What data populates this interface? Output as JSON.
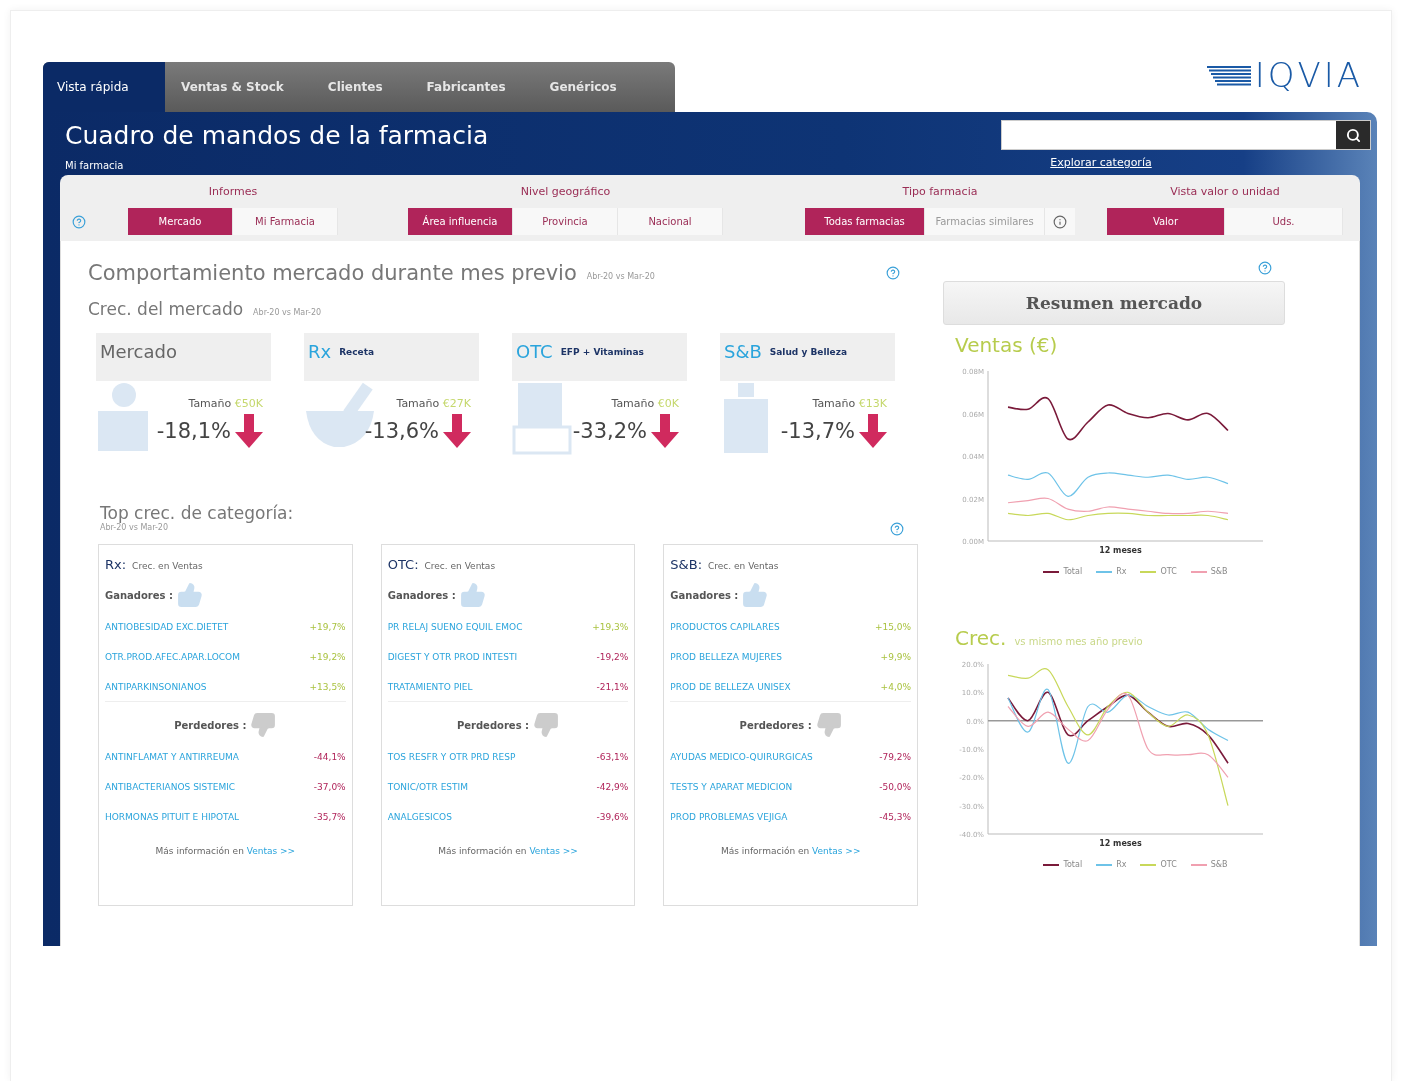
{
  "tabs": [
    {
      "label": "Vista rápida",
      "selected": true
    },
    {
      "label": "Ventas & Stock",
      "selected": false
    },
    {
      "label": "Clientes",
      "selected": false
    },
    {
      "label": "Fabricantes",
      "selected": false
    },
    {
      "label": "Genéricos",
      "selected": false
    }
  ],
  "logo": "IQVIA",
  "header": {
    "title": "Cuadro de mandos de la farmacia",
    "subtitle": "Mi farmacia",
    "explore_link": "Explorar categoría"
  },
  "filters": [
    {
      "label": "Informes",
      "help_icon": true,
      "info_icon": false,
      "options": [
        {
          "label": "Mercado",
          "selected": true
        },
        {
          "label": "Mi Farmacia",
          "selected": false
        }
      ]
    },
    {
      "label": "Nivel geográfico",
      "help_icon": false,
      "info_icon": false,
      "options": [
        {
          "label": "Área influencia",
          "selected": true
        },
        {
          "label": "Provincia",
          "selected": false
        },
        {
          "label": "Nacional",
          "selected": false
        }
      ]
    },
    {
      "label": "Tipo farmacia",
      "help_icon": false,
      "info_icon": true,
      "options": [
        {
          "label": "Todas farmacias",
          "selected": true
        },
        {
          "label": "Farmacias similares",
          "selected": false
        }
      ]
    },
    {
      "label": "Vista valor o unidad",
      "help_icon": false,
      "info_icon": false,
      "options": [
        {
          "label": "Valor",
          "selected": true
        },
        {
          "label": "Uds.",
          "selected": false
        }
      ]
    }
  ],
  "market": {
    "title": "Comportamiento mercado durante mes previo",
    "period": "Abr-20 vs Mar-20",
    "growth_title": "Crec. del mercado",
    "growth_period": "Abr-20 vs Mar-20",
    "cards": [
      {
        "kind": "mercado",
        "code": "Mercado",
        "size_label": "Tamaño",
        "size_value": "€50K",
        "change": "-18,1%",
        "declining": true
      },
      {
        "kind": "rx",
        "code": "Rx",
        "name": "Receta",
        "size_label": "Tamaño",
        "size_value": "€27K",
        "change": "-13,6%",
        "declining": true
      },
      {
        "kind": "otc",
        "code": "OTC",
        "name": "EFP + Vitaminas",
        "size_label": "Tamaño",
        "size_value": "€0K",
        "change": "-33,2%",
        "declining": true
      },
      {
        "kind": "sb",
        "code": "S&B",
        "name": "Salud y Belleza",
        "size_label": "Tamaño",
        "size_value": "€13K",
        "change": "-13,7%",
        "declining": true
      }
    ]
  },
  "top": {
    "title": "Top crec. de categoría:",
    "period": "Abr-20 vs Mar-20",
    "panels": [
      {
        "code": "Rx:",
        "label": "Crec. en Ventas",
        "winners_label": "Ganadores :",
        "losers_label": "Perdedores :",
        "more_text": "Más información en",
        "more_link": "Ventas >>",
        "winners": [
          {
            "name": "ANTIOBESIDAD EXC.DIETET",
            "value": "+19,7%",
            "positive": true
          },
          {
            "name": "OTR.PROD.AFEC.APAR.LOCOM",
            "value": "+19,2%",
            "positive": true
          },
          {
            "name": "ANTIPARKINSONIANOS",
            "value": "+13,5%",
            "positive": true
          }
        ],
        "losers": [
          {
            "name": "ANTINFLAMAT Y ANTIRREUMA",
            "value": "-44,1%",
            "positive": false
          },
          {
            "name": "ANTIBACTERIANOS SISTEMIC",
            "value": "-37,0%",
            "positive": false
          },
          {
            "name": "HORMONAS PITUIT E HIPOTAL",
            "value": "-35,7%",
            "positive": false
          }
        ]
      },
      {
        "code": "OTC:",
        "label": "Crec. en Ventas",
        "winners_label": "Ganadores :",
        "losers_label": "Perdedores :",
        "more_text": "Más información en",
        "more_link": "Ventas >>",
        "winners": [
          {
            "name": "PR RELAJ SUENO EQUIL EMOC",
            "value": "+19,3%",
            "positive": true
          },
          {
            "name": "DIGEST Y OTR PROD INTESTI",
            "value": "-19,2%",
            "positive": false
          },
          {
            "name": "TRATAMIENTO PIEL",
            "value": "-21,1%",
            "positive": false
          }
        ],
        "losers": [
          {
            "name": "TOS RESFR Y OTR PRD RESP",
            "value": "-63,1%",
            "positive": false
          },
          {
            "name": "TONIC/OTR ESTIM",
            "value": "-42,9%",
            "positive": false
          },
          {
            "name": "ANALGESICOS",
            "value": "-39,6%",
            "positive": false
          }
        ]
      },
      {
        "code": "S&B:",
        "label": "Crec. en Ventas",
        "winners_label": "Ganadores :",
        "losers_label": "Perdedores :",
        "more_text": "Más información en",
        "more_link": "Ventas >>",
        "winners": [
          {
            "name": "PRODUCTOS CAPILARES",
            "value": "+15,0%",
            "positive": true
          },
          {
            "name": "PROD BELLEZA MUJERES",
            "value": "+9,9%",
            "positive": true
          },
          {
            "name": "PROD DE BELLEZA UNISEX",
            "value": "+4,0%",
            "positive": true
          }
        ],
        "losers": [
          {
            "name": "AYUDAS MEDICO-QUIRURGICAS",
            "value": "-79,2%",
            "positive": false
          },
          {
            "name": "TESTS Y APARAT MEDICION",
            "value": "-50,0%",
            "positive": false
          },
          {
            "name": "PROD PROBLEMAS VEJIGA",
            "value": "-45,3%",
            "positive": false
          }
        ]
      }
    ]
  },
  "summary": {
    "button": "Resumen mercado",
    "sales": {
      "title": "Ventas (€)",
      "chart_data": {
        "type": "line",
        "legend": "bottom",
        "xlabel": "12 meses",
        "ylim": [
          0,
          0.08
        ],
        "yticks": [
          {
            "value": 0,
            "label": "0.00M"
          },
          {
            "value": 0.02,
            "label": "0.02M"
          },
          {
            "value": 0.04,
            "label": "0.04M"
          },
          {
            "value": 0.06,
            "label": "0.06M"
          },
          {
            "value": 0.08,
            "label": "0.08M"
          }
        ],
        "series": [
          {
            "name": "Total",
            "color": "#7a1a3a",
            "values": [
              0.063,
              0.062,
              0.067,
              0.048,
              0.056,
              0.064,
              0.06,
              0.058,
              0.06,
              0.057,
              0.06,
              0.052
            ]
          },
          {
            "name": "Rx",
            "color": "#6ec3e8",
            "values": [
              0.031,
              0.029,
              0.032,
              0.021,
              0.03,
              0.032,
              0.031,
              0.03,
              0.031,
              0.029,
              0.03,
              0.027
            ]
          },
          {
            "name": "OTC",
            "color": "#c8d85a",
            "values": [
              0.013,
              0.012,
              0.013,
              0.01,
              0.012,
              0.013,
              0.013,
              0.012,
              0.012,
              0.012,
              0.012,
              0.01
            ]
          },
          {
            "name": "S&B",
            "color": "#f0a0b0",
            "values": [
              0.018,
              0.019,
              0.02,
              0.015,
              0.014,
              0.016,
              0.015,
              0.014,
              0.013,
              0.013,
              0.014,
              0.013
            ]
          }
        ]
      }
    },
    "growth": {
      "title": "Crec.",
      "subtitle": "vs mismo mes año previo",
      "chart_data": {
        "type": "line",
        "legend": "bottom",
        "xlabel": "12 meses",
        "ylim": [
          -40,
          20
        ],
        "yticks": [
          {
            "value": 20,
            "label": "20.0%"
          },
          {
            "value": 10,
            "label": "10.0%"
          },
          {
            "value": 0,
            "label": "0.0%"
          },
          {
            "value": -10,
            "label": "-10.0%"
          },
          {
            "value": -20,
            "label": "-20.0%"
          },
          {
            "value": -30,
            "label": "-30.0%"
          },
          {
            "value": -40,
            "label": "-40.0%"
          }
        ],
        "series": [
          {
            "name": "Total",
            "color": "#7a1a3a",
            "values": [
              8,
              0,
              10,
              -5,
              0,
              5,
              9,
              3,
              -2,
              -1,
              -5,
              -15
            ]
          },
          {
            "name": "Rx",
            "color": "#6ec3e8",
            "values": [
              8,
              -4,
              11,
              -15,
              5,
              3,
              9,
              5,
              2,
              3,
              -3,
              -7
            ]
          },
          {
            "name": "OTC",
            "color": "#c8d85a",
            "values": [
              16,
              15,
              18,
              5,
              -5,
              5,
              10,
              3,
              -2,
              2,
              -5,
              -30
            ]
          },
          {
            "name": "S&B",
            "color": "#f0a0b0",
            "values": [
              5,
              -2,
              3,
              -3,
              -7,
              4,
              9,
              -10,
              -12,
              -12,
              -12,
              -20
            ]
          }
        ]
      }
    }
  }
}
